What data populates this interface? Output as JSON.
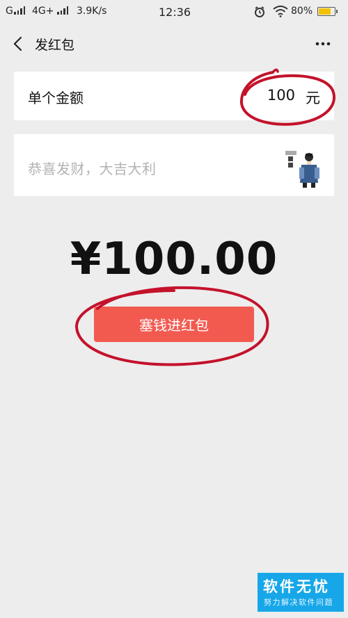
{
  "status_bar": {
    "carrier": "G",
    "network": "4G+",
    "speed": "3.9K/s",
    "time": "12:36",
    "battery": "80%",
    "icons": [
      "signal-icon",
      "signal-icon",
      "alarm-icon",
      "wifi-icon",
      "battery-icon"
    ]
  },
  "nav": {
    "title": "发红包",
    "back_icon": "back-arrow-icon",
    "more_icon": "more-dots-icon"
  },
  "amount": {
    "label": "单个金额",
    "value": "100",
    "unit": "元"
  },
  "blessing": {
    "placeholder": "恭喜发财，大吉大利",
    "sticker_icon": "sticker-icon"
  },
  "total": "¥100.00",
  "send_button": {
    "label": "塞钱进红包",
    "color": "#f25a50"
  },
  "watermark": {
    "title": "软件无忧",
    "subtitle": "努力解决软件问题",
    "color": "#17a7e8"
  },
  "colors": {
    "background": "#ededed",
    "annotation": "#c4122b",
    "battery": "#f2c200"
  }
}
